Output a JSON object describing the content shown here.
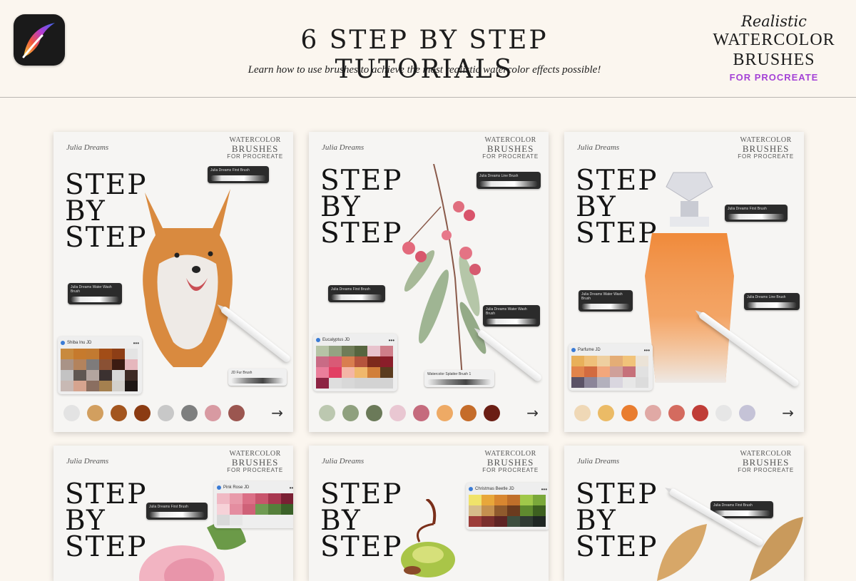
{
  "header": {
    "title": "6 STEP BY STEP TUTORIALS",
    "subtitle": "Learn how to use brushes to achieve the most realistic watercolor effects possible!",
    "brand_realistic": "Realistic",
    "brand_line1": "WATERCOLOR",
    "brand_line2": "BRUSHES",
    "brand_for": "FOR PROCREATE",
    "app_icon": "procreate-icon"
  },
  "colors": {
    "background": "#fbf6ef",
    "brand_for": "#a442d6",
    "card": "#f6f5f3"
  },
  "card_common": {
    "signature": "Julia Dreams",
    "wm1": "WATERCOLOR",
    "wm2": "BRUSHES",
    "wm3": "FOR PROCREATE",
    "step1": "STEP",
    "step2": "BY",
    "step3": "STEP",
    "arrow": "→"
  },
  "cards": [
    {
      "subject": "dog",
      "palette_name": "Shiba Inu JD",
      "brushes": [
        "Julia Dreams First Brush",
        "Julia Dreams Water Wash Brush",
        "JD Fur Brush"
      ],
      "palette": [
        "#c88a3e",
        "#c67a2d",
        "#c27a31",
        "#a24d17",
        "#8d3e16",
        "#e4e4e4",
        "#a99387",
        "#b3835d",
        "#7e7b7b",
        "#8a5134",
        "#3b1b12",
        "#e6b7bd",
        "#c3c3c3",
        "#5f5752",
        "#b3a59f",
        "#3b3130",
        "#d8d8d8",
        "#3e2b25",
        "#c8b9b4",
        "#d6a48f",
        "#8a6e60",
        "#a5804f",
        "#d3d0cc",
        "#1e1715"
      ],
      "dots": [
        "#e3e3e3",
        "#d29f5f",
        "#a3551e",
        "#8b3b12",
        "#c8c8c8",
        "#7e7f7f",
        "#d89aa2",
        "#9b5650"
      ]
    },
    {
      "subject": "eucalyptus",
      "palette_name": "Eucalyptus JD",
      "brushes": [
        "Julia Dreams Line Brush",
        "Julia Dreams First Brush",
        "Julia Dreams Water Wash Brush",
        "Watercolor Splatter Brush 1"
      ],
      "palette": [
        "#b6c4a6",
        "#94a382",
        "#6f7c58",
        "#56653f",
        "#e8c3cd",
        "#cf7e8a",
        "#c96b85",
        "#d95a76",
        "#d97e4f",
        "#b5543d",
        "#7d2a1c",
        "#8b1e2a",
        "#ea7e9b",
        "#e23f63",
        "#f4b6a6",
        "#f0b86c",
        "#d17f3a",
        "#5a3b1e",
        "#8d2343",
        "#dedede",
        "#d8d8d8",
        "#d3d3d3",
        "#d3d3d3",
        "#d3d3d3"
      ],
      "dots": [
        "#bcc8b0",
        "#8fa07e",
        "#6b7a59",
        "#e9c7d2",
        "#c56b7d",
        "#eeaa65",
        "#c56c2a",
        "#6b1e14"
      ]
    },
    {
      "subject": "perfume",
      "palette_name": "Parfume JD",
      "brushes": [
        "Julia Dreams First Brush",
        "Julia Dreams Water Wash Brush",
        "Julia Dreams Line Brush"
      ],
      "palette": [
        "#e8b05a",
        "#efc07a",
        "#eecfa0",
        "#e4ad76",
        "#f1c37a",
        "#ebe3d7",
        "#e2844b",
        "#d26b40",
        "#f2a77c",
        "#cfa09a",
        "#c6717a",
        "#e1e1e1",
        "#5b5367",
        "#8b8599",
        "#b3b1bd",
        "#d9d6df",
        "#e7e7e7",
        "#dcdcdc"
      ],
      "dots": [
        "#efd8b6",
        "#ebbb66",
        "#e97d2f",
        "#e0a9a5",
        "#d46b5f",
        "#c03d37",
        "#e6e6e6",
        "#c5c3d7"
      ]
    },
    {
      "subject": "rose",
      "palette_name": "Pink Rose JD",
      "brushes": [
        "Julia Dreams First Brush"
      ],
      "palette": [
        "#f0b9c4",
        "#e89aaa",
        "#db6f86",
        "#c8546c",
        "#a83750",
        "#7a1f33",
        "#f6d2d8",
        "#e48da0",
        "#cf6178",
        "#6f9a52",
        "#557f3b",
        "#3a6128",
        "#d9d9d9",
        "#e6e6e6"
      ]
    },
    {
      "subject": "beetle",
      "palette_name": "Christmas Beetle JD",
      "brushes": [],
      "palette": [
        "#f0e36a",
        "#e8a73a",
        "#d88630",
        "#c06f2a",
        "#a0c84a",
        "#7aa83a",
        "#d6bc8a",
        "#c4904f",
        "#8f5a2d",
        "#6b3b1e",
        "#5f8a2f",
        "#3d6020",
        "#9c3d3a",
        "#7a2f2d",
        "#5e2424",
        "#3d4f3f",
        "#2f3a33",
        "#1e2623"
      ]
    },
    {
      "subject": "leaves",
      "palette_name": "",
      "brushes": [
        "Julia Dreams First Brush"
      ],
      "palette": []
    }
  ]
}
